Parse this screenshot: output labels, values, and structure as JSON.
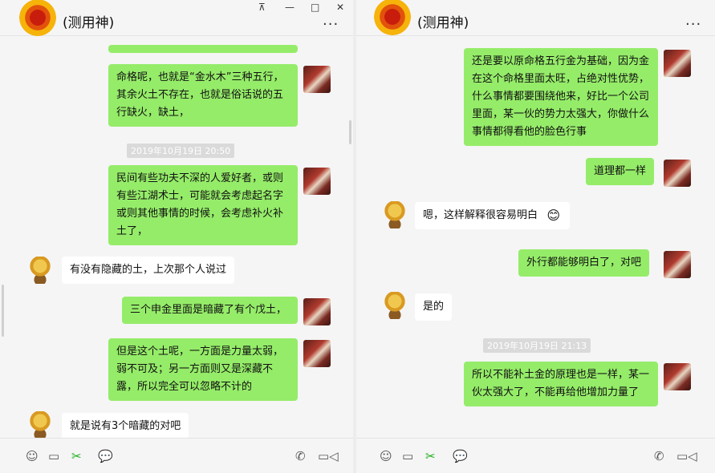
{
  "left": {
    "title": "(测用神)",
    "more": "···",
    "window_controls": {
      "pin": "⊼",
      "minimize": "—",
      "maximize": "□",
      "close": "✕"
    },
    "messages": [
      {
        "text": "命格呢，也就是“金水木”三种五行，其余火土不存在，也就是俗话说的五行缺火，缺土，"
      },
      {
        "timestamp": "2019年10月19日 20:50"
      },
      {
        "text": "民间有些功夫不深的人爱好者，或则有些江湖术士，可能就会考虑起名字或则其他事情的时候，会考虑补火补土了，"
      },
      {
        "text": "有没有隐藏的土，上次那个人说过"
      },
      {
        "text": "三个申金里面是暗藏了有个戊土，"
      },
      {
        "text": "但是这个土呢，一方面是力量太弱，弱不可及；另一方面则又是深藏不露，所以完全可以忽略不计的"
      },
      {
        "text": "就是说有3个暗藏的对吧"
      }
    ]
  },
  "right": {
    "title": "(测用神)",
    "more": "···",
    "messages": [
      {
        "text": "还是要以原命格五行金为基础，因为金在这个命格里面太旺，占绝对性优势，什么事情都要围绕他来，好比一个公司里面，某一伙的势力太强大，你做什么事情都得看他的脸色行事"
      },
      {
        "text": "道理都一样"
      },
      {
        "text": "嗯，这样解释很容易明白"
      },
      {
        "text": "外行都能够明白了，对吧"
      },
      {
        "text": "是的"
      },
      {
        "timestamp": "2019年10月19日 21:13"
      },
      {
        "text": "所以不能补土金的原理也是一样，某一伙太强大了，不能再给他增加力量了"
      }
    ]
  },
  "emoji": "😊",
  "toolbar_icons": {
    "emoji": "☺",
    "folder": "▭",
    "scissors": "✂",
    "chat": "💬",
    "phone": "✆",
    "video": "▭◁"
  }
}
